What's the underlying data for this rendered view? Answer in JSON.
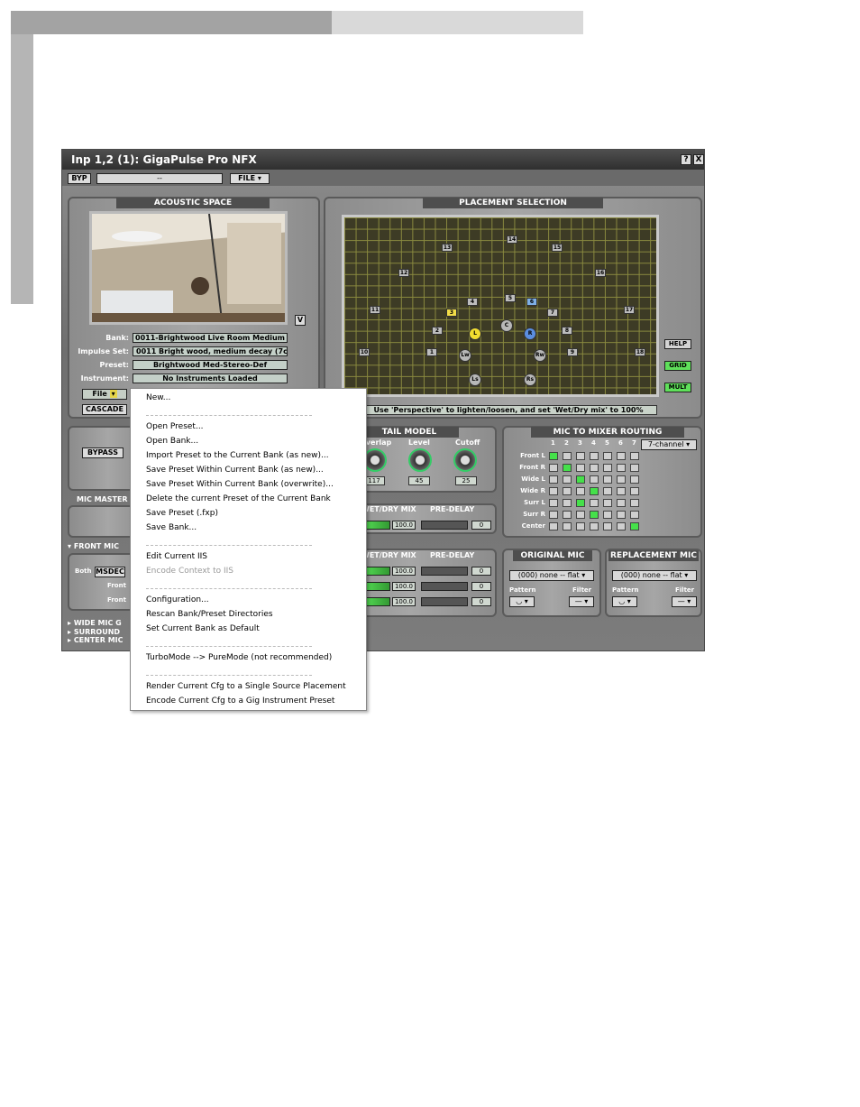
{
  "window": {
    "title": "Inp 1,2 (1): GigaPulse Pro NFX",
    "help_btn": "?",
    "close_btn": "X"
  },
  "toolbar": {
    "byp": "BYP",
    "preset_value": "--",
    "file": "FILE"
  },
  "acoustic": {
    "header": "ACOUSTIC SPACE",
    "v_btn": "V",
    "bank_label": "Bank:",
    "bank_value": "0011-Brightwood Live Room Medium",
    "impulse_label": "Impulse Set:",
    "impulse_value": "0011 Bright wood, medium decay (7ch/1",
    "preset_label": "Preset:",
    "preset_value": "Brightwood Med-Stereo-Def",
    "instrument_label": "Instrument:",
    "instrument_value": "No Instruments Loaded",
    "file_btn": "File",
    "cascade_btn": "CASCADE"
  },
  "bypass_btn": "BYPASS",
  "placement": {
    "header": "PLACEMENT SELECTION",
    "status": "Use 'Perspective' to lighten/loosen, and set 'Wet/Dry mix' to 100%",
    "numbers": [
      "1",
      "2",
      "3",
      "4",
      "5",
      "6",
      "7",
      "8",
      "9",
      "10",
      "11",
      "12",
      "13",
      "14",
      "15",
      "16",
      "17",
      "18"
    ],
    "mics": [
      "L",
      "C",
      "R",
      "Lw",
      "Rw",
      "Ls",
      "Rs"
    ]
  },
  "side_buttons": {
    "help": "HELP",
    "grid": "GRID",
    "mult": "MULT"
  },
  "tail": {
    "header": "TAIL MODEL",
    "overlap": "Overlap",
    "level": "Level",
    "cutoff": "Cutoff",
    "overlap_val": "117",
    "level_val": "45",
    "cutoff_val": "25"
  },
  "routing": {
    "header": "MIC TO MIXER ROUTING",
    "mode": "7-channel",
    "cols": [
      "1",
      "2",
      "3",
      "4",
      "5",
      "6",
      "7"
    ],
    "rows": [
      "Front L",
      "Front R",
      "Wide L",
      "Wide R",
      "Surr L",
      "Surr R",
      "Center"
    ],
    "active": [
      0,
      1,
      2,
      3,
      2,
      3,
      6
    ]
  },
  "mic_master": "MIC MASTER",
  "front_mic": "FRONT MIC",
  "both": "Both",
  "msdec": "MSDEC",
  "front_a": "Front",
  "front_b": "Front",
  "wide_mic": "WIDE MIC G",
  "surround": "SURROUND",
  "center_mic": "CENTER MIC",
  "mix1": {
    "wet_dry": "WET/DRY MIX",
    "pre_delay": "PRE-DELAY",
    "val": "100.0",
    "delay": "0"
  },
  "mix2": {
    "wet_dry": "WET/DRY MIX",
    "pre_delay": "PRE-DELAY",
    "vals": [
      "100.0",
      "100.0",
      "100.0"
    ],
    "delays": [
      "0",
      "0",
      "0"
    ]
  },
  "original": {
    "header": "ORIGINAL MIC",
    "select": "(000) none -- flat",
    "pattern": "Pattern",
    "filter": "Filter"
  },
  "replacement": {
    "header": "REPLACEMENT MIC",
    "select": "(000) none -- flat",
    "pattern": "Pattern",
    "filter": "Filter"
  },
  "menu": {
    "items": [
      {
        "label": "New...",
        "disabled": false
      },
      {
        "label": "Open Preset...",
        "disabled": false
      },
      {
        "label": "Open Bank...",
        "disabled": false
      },
      {
        "label": "Import Preset to the Current Bank (as new)...",
        "disabled": false
      },
      {
        "label": "Save Preset Within Current Bank (as new)...",
        "disabled": false
      },
      {
        "label": "Save Preset Within Current Bank (overwrite)...",
        "disabled": false
      },
      {
        "label": "Delete the current Preset of the Current Bank",
        "disabled": false
      },
      {
        "label": "Save Preset (.fxp)",
        "disabled": false
      },
      {
        "label": "Save Bank...",
        "disabled": false
      },
      {
        "label": "Edit Current IIS",
        "disabled": false
      },
      {
        "label": "Encode Context to IIS",
        "disabled": true
      },
      {
        "label": "Configuration...",
        "disabled": false
      },
      {
        "label": "Rescan Bank/Preset Directories",
        "disabled": false
      },
      {
        "label": "Set Current Bank as Default",
        "disabled": false
      },
      {
        "label": "TurboMode --> PureMode  (not recommended)",
        "disabled": false
      },
      {
        "label": "Render Current Cfg to a Single Source Placement",
        "disabled": false
      },
      {
        "label": "Encode Current Cfg to a Gig Instrument Preset",
        "disabled": false
      }
    ]
  }
}
